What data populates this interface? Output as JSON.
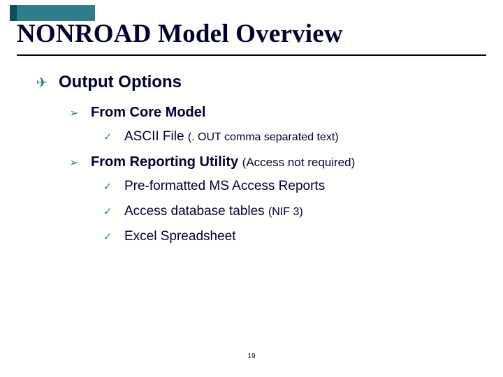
{
  "title": "NONROAD Model Overview",
  "outline": {
    "lvl1": {
      "text": "Output Options"
    },
    "lvl2a": {
      "text": "From Core Model"
    },
    "lvl3a": {
      "text": "ASCII File ",
      "paren": "(. OUT comma separated text)"
    },
    "lvl2b": {
      "text": "From Reporting Utility ",
      "paren": "(Access not required)"
    },
    "lvl3b": {
      "text": "Pre-formatted MS Access Reports"
    },
    "lvl3c": {
      "text": "Access database tables ",
      "paren": "(NIF 3)"
    },
    "lvl3d": {
      "text": "Excel Spreadsheet"
    }
  },
  "page_number": "19"
}
